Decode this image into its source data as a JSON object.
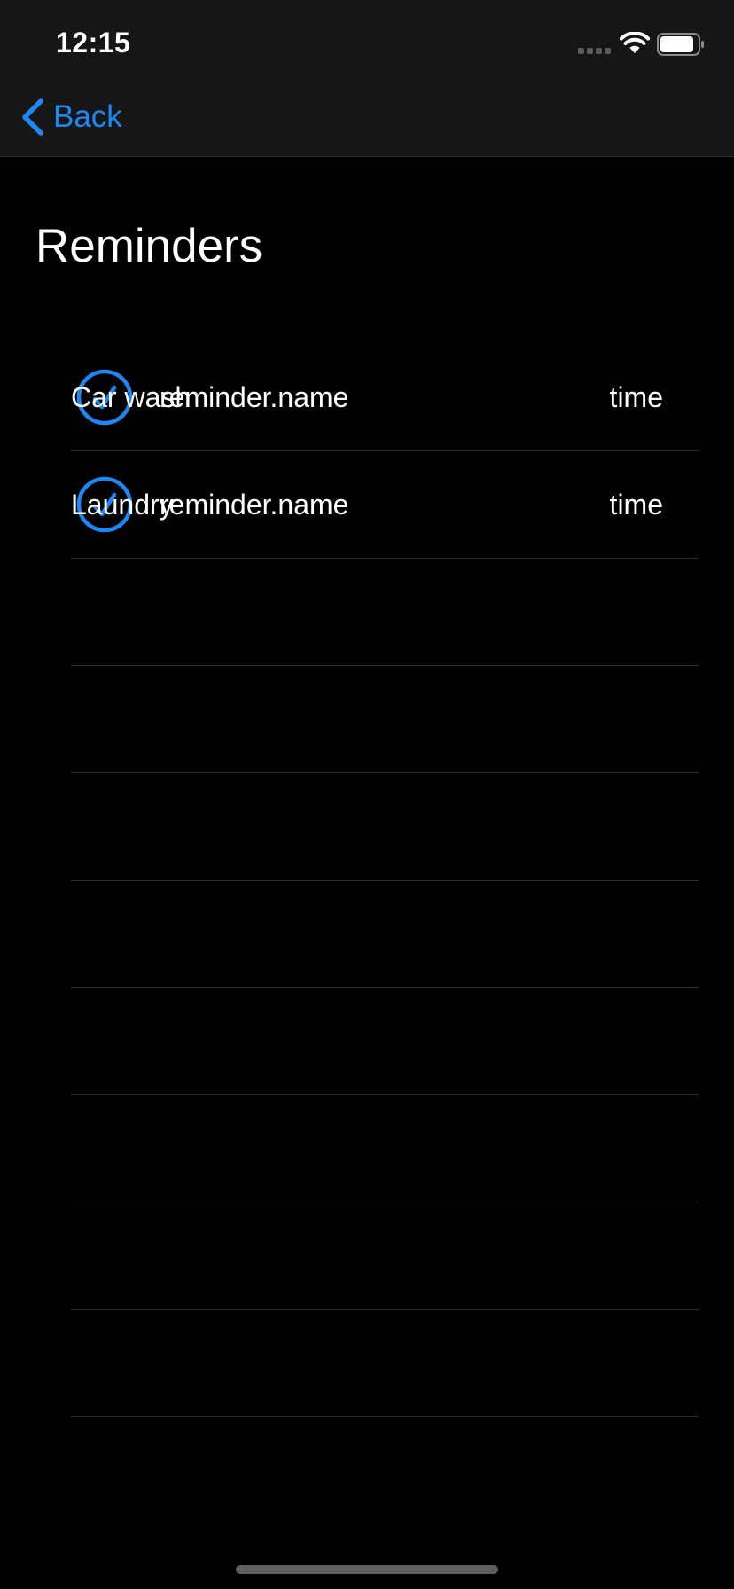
{
  "status_bar": {
    "time": "12:15"
  },
  "nav": {
    "back_label": "Back",
    "back_icon": "chevron-left-icon"
  },
  "page": {
    "title": "Reminders"
  },
  "colors": {
    "accent": "#1f86f5",
    "background": "#000000",
    "bar_background": "#161616",
    "separator": "#2d2d2d"
  },
  "reminders": [
    {
      "title": "Car wash",
      "name": "reminder.name",
      "time": "time",
      "completed": true
    },
    {
      "title": "Laundry",
      "name": "reminder.name",
      "time": "time",
      "completed": true
    }
  ],
  "empty_rows": 8
}
